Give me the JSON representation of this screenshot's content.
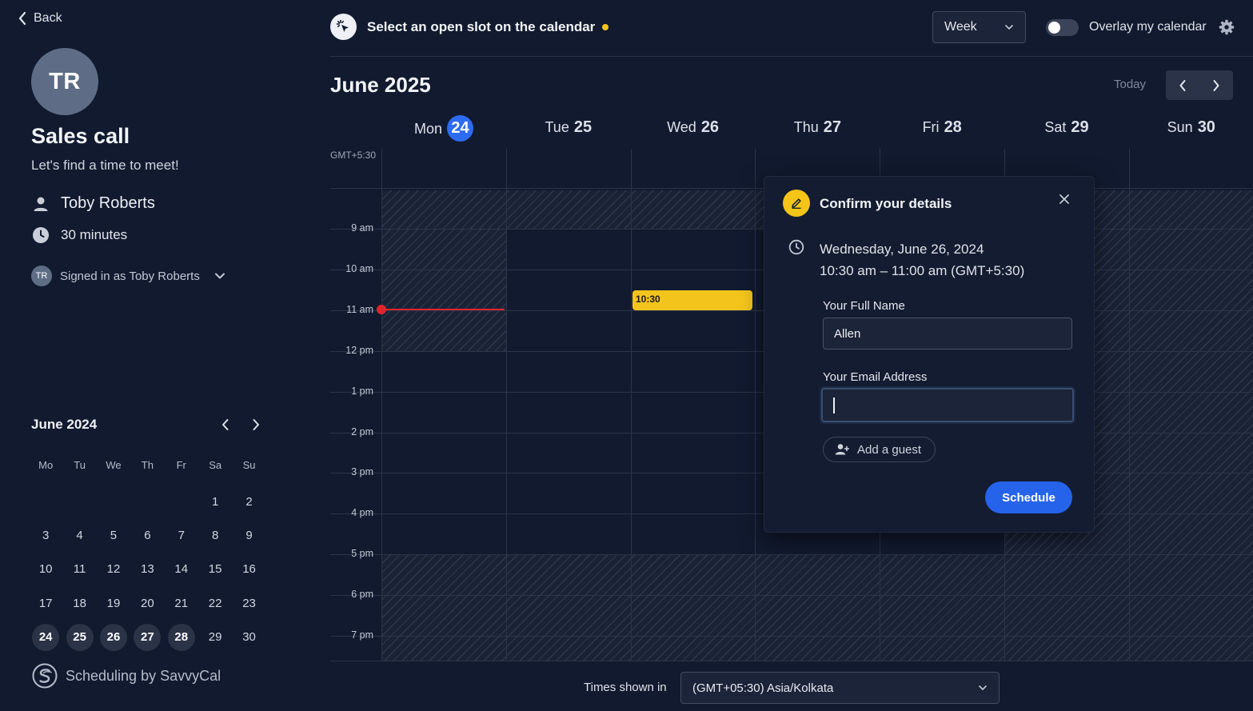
{
  "sidebar": {
    "back_label": "Back",
    "avatar_initials": "TR",
    "event_title": "Sales call",
    "event_subtitle": "Let's find a time to meet!",
    "host_name": "Toby Roberts",
    "duration": "30 minutes",
    "signed_in_avatar": "TR",
    "signed_in_label": "Signed in as Toby Roberts"
  },
  "mini_calendar": {
    "title": "June 2024",
    "weekdays": [
      "Mo",
      "Tu",
      "We",
      "Th",
      "Fr",
      "Sa",
      "Su"
    ],
    "weeks": [
      [
        "",
        "",
        "",
        "",
        "",
        "1",
        "2"
      ],
      [
        "3",
        "4",
        "5",
        "6",
        "7",
        "8",
        "9"
      ],
      [
        "10",
        "11",
        "12",
        "13",
        "14",
        "15",
        "16"
      ],
      [
        "17",
        "18",
        "19",
        "20",
        "21",
        "22",
        "23"
      ],
      [
        "24",
        "25",
        "26",
        "27",
        "28",
        "29",
        "30"
      ]
    ],
    "available_days": [
      "24",
      "25",
      "26",
      "27",
      "28"
    ]
  },
  "branding": {
    "label": "Scheduling by SavvyCal"
  },
  "topbar": {
    "prompt": "Select an open slot on the calendar",
    "view_selected": "Week",
    "overlay_label": "Overlay my calendar",
    "overlay_enabled": false
  },
  "calendar": {
    "month_title": "June 2025",
    "today_label": "Today",
    "timezone_abbr": "GMT+5:30",
    "days": [
      {
        "name": "Mon",
        "num": "24",
        "today": true
      },
      {
        "name": "Tue",
        "num": "25"
      },
      {
        "name": "Wed",
        "num": "26"
      },
      {
        "name": "Thu",
        "num": "27"
      },
      {
        "name": "Fri",
        "num": "28"
      },
      {
        "name": "Sat",
        "num": "29"
      },
      {
        "name": "Sun",
        "num": "30"
      }
    ],
    "hours": [
      "9 am",
      "10 am",
      "11 am",
      "12 pm",
      "1 pm",
      "2 pm",
      "3 pm",
      "4 pm",
      "5 pm",
      "6 pm",
      "7 pm"
    ],
    "event": {
      "label": "10:30",
      "color": "#f3c51c"
    }
  },
  "confirm": {
    "title": "Confirm your details",
    "date_line": "Wednesday, June 26, 2024",
    "time_line": "10:30 am – 11:00 am (GMT+5:30)",
    "name_label": "Your Full Name",
    "name_value": "Allen",
    "email_label": "Your Email Address",
    "email_value": "",
    "add_guest_label": "Add a guest",
    "schedule_label": "Schedule"
  },
  "footer": {
    "times_shown_label": "Times shown in",
    "timezone_value": "(GMT+05:30) Asia/Kolkata"
  },
  "colors": {
    "background": "#111a2f",
    "accent_blue": "#2563eb",
    "accent_yellow": "#f4c518",
    "now_red": "#e0262c"
  }
}
